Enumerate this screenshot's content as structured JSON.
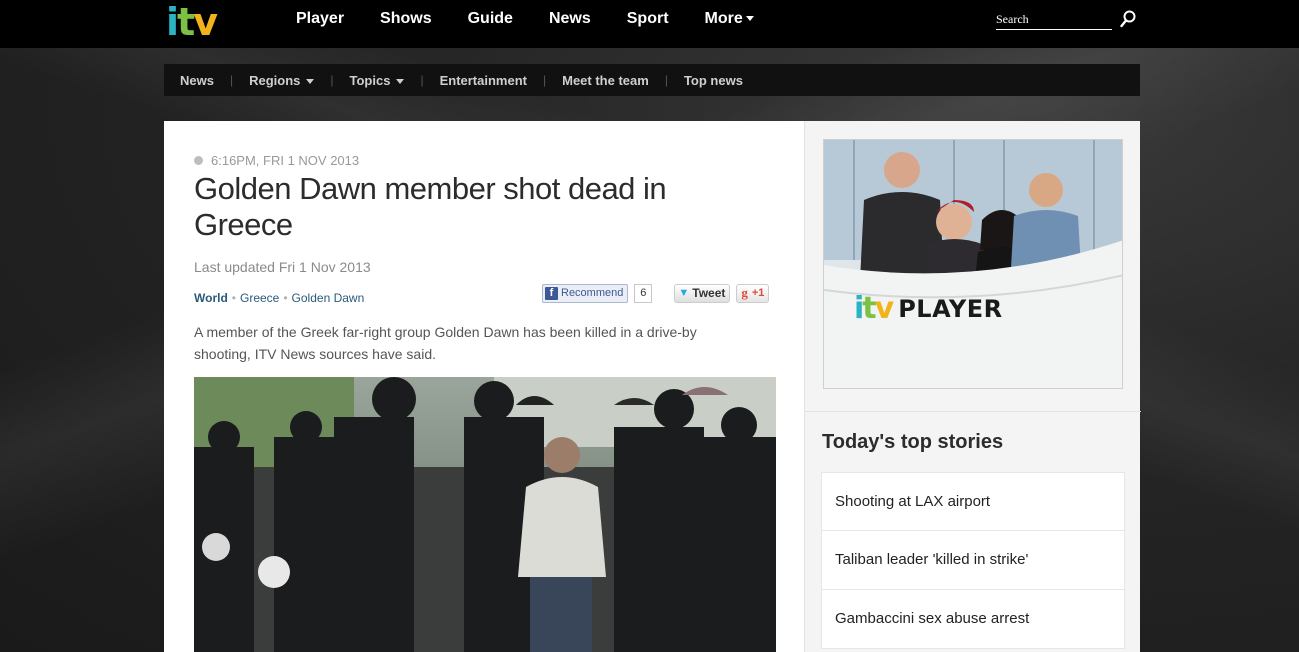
{
  "topnav": {
    "items": [
      "Player",
      "Shows",
      "Guide",
      "News",
      "Sport",
      "More"
    ],
    "search_placeholder": "Search"
  },
  "logo": {
    "letters": [
      "i",
      "t",
      "v"
    ]
  },
  "subnav": {
    "items": [
      "News",
      "Regions",
      "Topics",
      "Entertainment",
      "Meet the team",
      "Top news"
    ]
  },
  "article": {
    "timestamp": "6:16PM, FRI 1 NOV 2013",
    "headline": "Golden Dawn member shot dead in Greece",
    "updated": "Last updated Fri 1 Nov 2013",
    "tags": [
      "World",
      "Greece",
      "Golden Dawn"
    ],
    "share": {
      "recommend": "Recommend",
      "recommend_count": "6",
      "tweet": "Tweet",
      "gplus": "+1",
      "g": "g"
    },
    "standfirst": "A member of the Greek far-right group Golden Dawn has been killed in a drive-by shooting, ITV News sources have said."
  },
  "sidebar": {
    "promo_label": "PLAYER",
    "top_stories_title": "Today's top stories",
    "stories": [
      "Shooting at LAX airport",
      "Taliban leader 'killed in strike'",
      "Gambaccini sex abuse arrest"
    ]
  },
  "colors": {
    "brand_teal": "#2bb3c4",
    "brand_green": "#7bc143",
    "brand_yellow": "#f2b21b",
    "brand_pink": "#e8467c",
    "link": "#2a5b7a"
  }
}
